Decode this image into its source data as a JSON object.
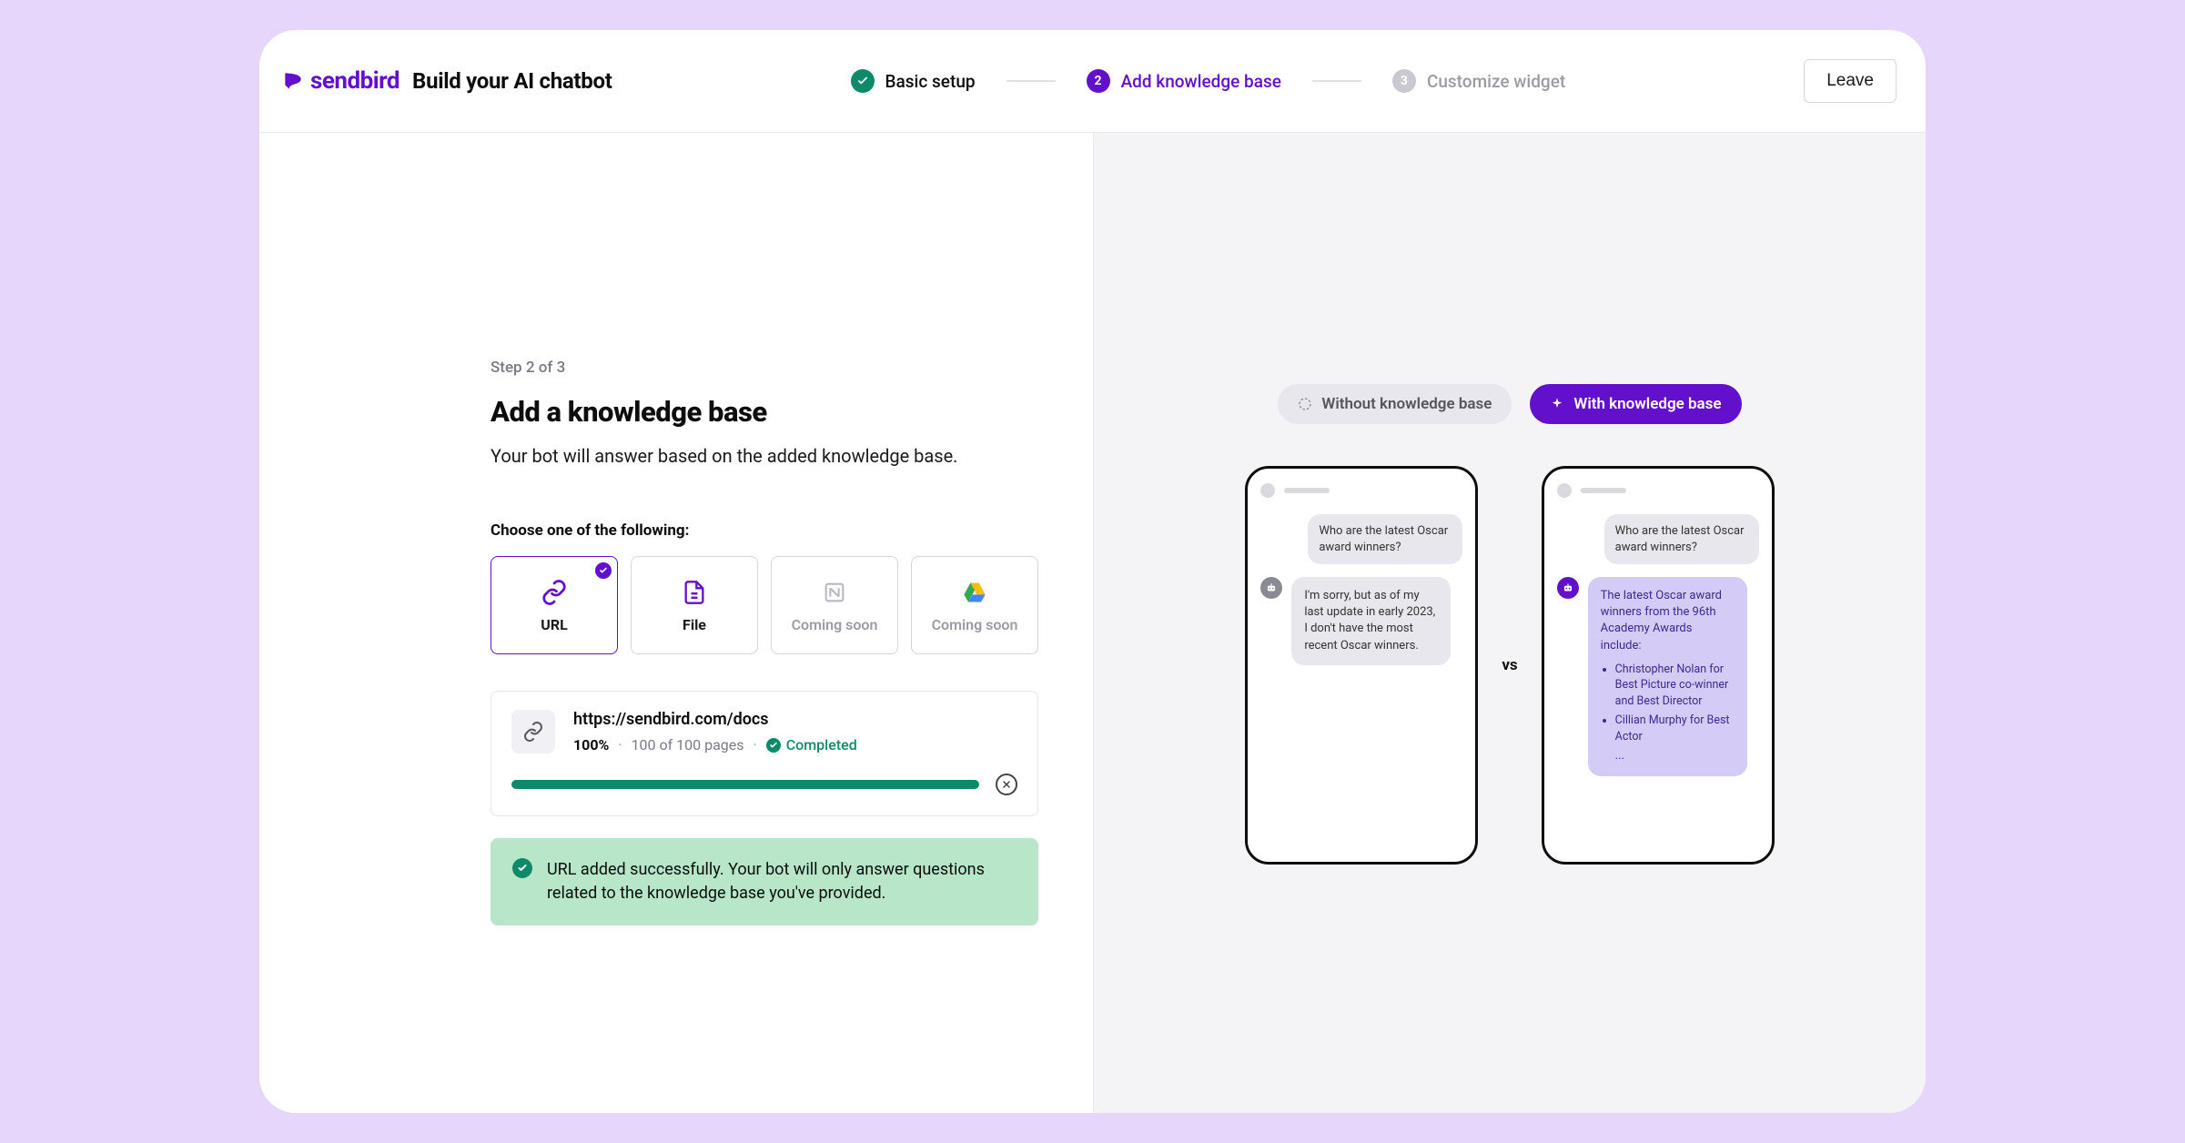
{
  "header": {
    "brand": "sendbird",
    "title": "Build your AI chatbot",
    "leave_label": "Leave",
    "steps": [
      {
        "label": "Basic setup",
        "state": "done"
      },
      {
        "label": "Add knowledge base",
        "state": "active",
        "num": "2"
      },
      {
        "label": "Customize widget",
        "state": "pending",
        "num": "3"
      }
    ]
  },
  "left": {
    "step_tag": "Step 2 of 3",
    "title": "Add a knowledge base",
    "subtitle": "Your bot will answer based on the added knowledge base.",
    "choose_label": "Choose one of the following:",
    "options": [
      {
        "label": "URL",
        "kind": "url",
        "selected": true
      },
      {
        "label": "File",
        "kind": "file",
        "selected": false
      },
      {
        "label": "Coming soon",
        "kind": "notion",
        "disabled": true
      },
      {
        "label": "Coming soon",
        "kind": "gdrive",
        "disabled": true
      }
    ],
    "upload": {
      "url": "https://sendbird.com/docs",
      "percent_label": "100%",
      "pages_label": "100 of 100 pages",
      "status_label": "Completed",
      "progress_pct": 100
    },
    "success_text": "URL added successfully. Your bot will only answer questions related to the knowledge base you've provided."
  },
  "right": {
    "tab_without": "Without knowledge base",
    "tab_with": "With knowledge base",
    "vs_label": "vs",
    "user_msg": "Who are the latest Oscar award winners?",
    "without_reply": "I'm sorry, but as of my last update in early 2023, I don't have the most recent Oscar winners.",
    "with_reply_intro": "The latest Oscar award winners from the 96th Academy Awards include:",
    "with_reply_items": [
      "Christopher Nolan for Best Picture co-winner and Best Director",
      "Cillian Murphy for Best Actor"
    ],
    "with_reply_ellipsis": "..."
  }
}
